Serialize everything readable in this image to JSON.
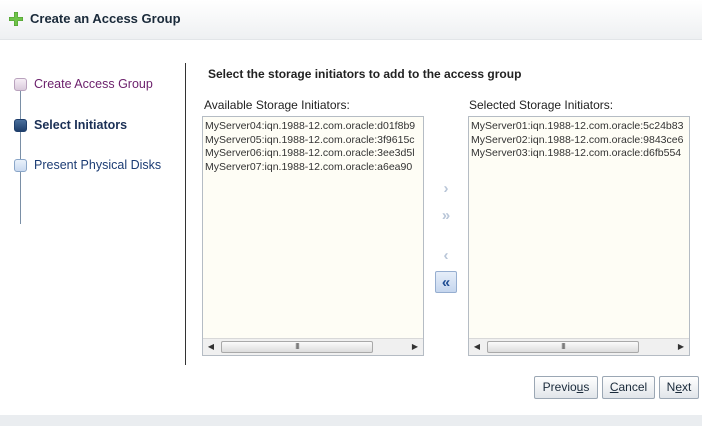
{
  "dialog": {
    "title": "Create an Access Group",
    "icon": "add-icon",
    "accent_color": "#4a9a2a"
  },
  "train": {
    "steps": [
      {
        "label": "Create Access Group",
        "state": "visited"
      },
      {
        "label": "Select Initiators",
        "state": "current"
      },
      {
        "label": "Present Physical Disks",
        "state": "next"
      }
    ]
  },
  "content": {
    "instruction": "Select the storage initiators to add to the access group",
    "available_label": "Available Storage Initiators:",
    "selected_label": "Selected Storage Initiators:",
    "available_items": [
      "MyServer04:iqn.1988-12.com.oracle:d01f8b9",
      "MyServer05:iqn.1988-12.com.oracle:3f9615c",
      "MyServer06:iqn.1988-12.com.oracle:3ee3d5l",
      "MyServer07:iqn.1988-12.com.oracle:a6ea90"
    ],
    "selected_items": [
      "MyServer01:iqn.1988-12.com.oracle:5c24b83",
      "MyServer02:iqn.1988-12.com.oracle:9843ce6",
      "MyServer03:iqn.1988-12.com.oracle:d6fb554"
    ],
    "scroll_thumb_grip": "III"
  },
  "shuttle": {
    "move": {
      "icon": "chevron-right-icon",
      "glyph": "›",
      "enabled": false
    },
    "move_all": {
      "icon": "double-chevron-right-icon",
      "glyph": "»",
      "enabled": false
    },
    "remove": {
      "icon": "chevron-left-icon",
      "glyph": "‹",
      "enabled": false
    },
    "remove_all": {
      "icon": "double-chevron-left-icon",
      "glyph": "«",
      "enabled": true
    }
  },
  "buttons": {
    "previous": {
      "before": "Previo",
      "mnemonic": "u",
      "after": "s"
    },
    "cancel": {
      "before": "",
      "mnemonic": "C",
      "after": "ancel"
    },
    "next": {
      "before": "N",
      "mnemonic": "e",
      "after": "xt"
    }
  }
}
